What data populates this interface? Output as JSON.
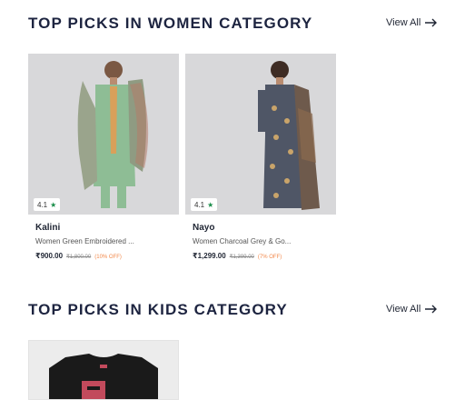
{
  "women": {
    "title": "TOP PICKS IN WOMEN CATEGORY",
    "view_all": "View All",
    "products": [
      {
        "rating": "4.1",
        "brand": "Kalini",
        "description": "Women Green Embroidered ...",
        "price": "₹900.00",
        "mrp": "₹1,800.00",
        "discount": "(10% OFF)",
        "colors": {
          "background": "#d8d8da",
          "kurta": "#8ebd95",
          "dupatta": "#9aa48c"
        }
      },
      {
        "rating": "4.1",
        "brand": "Nayo",
        "description": "Women Charcoal Grey & Go...",
        "price": "₹1,299.00",
        "mrp": "₹1,399.00",
        "discount": "(7% OFF)",
        "colors": {
          "background": "#d8d8da",
          "kurta": "#4f5666",
          "dupatta": "#6e5a4c"
        }
      }
    ]
  },
  "kids": {
    "title": "TOP PICKS IN KIDS CATEGORY",
    "view_all": "View All",
    "products": [
      {
        "colors": {
          "background": "#ececec",
          "tshirt": "#1a1a1a",
          "print": "#c24a5c"
        }
      }
    ]
  }
}
